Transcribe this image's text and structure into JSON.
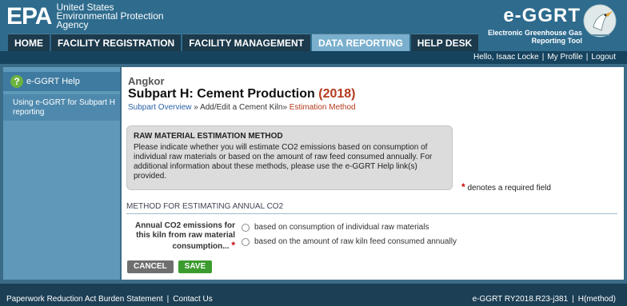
{
  "header": {
    "agency_mark": "EPA",
    "agency_line1": "United States",
    "agency_line2": "Environmental Protection",
    "agency_line3": "Agency",
    "brand_title": "e-GGRT",
    "brand_sub_line1": "Electronic Greenhouse Gas",
    "brand_sub_line2": "Reporting Tool"
  },
  "tabs": [
    {
      "label": "HOME"
    },
    {
      "label": "FACILITY REGISTRATION"
    },
    {
      "label": "FACILITY MANAGEMENT"
    },
    {
      "label": "DATA REPORTING",
      "active": true
    },
    {
      "label": "HELP DESK"
    }
  ],
  "userbar": {
    "greeting": "Hello, Isaac Locke",
    "my_profile": "My Profile",
    "logout": "Logout"
  },
  "sidebar": {
    "help_label": "e-GGRT Help",
    "help_icon": "?",
    "link_text": "Using e-GGRT for Subpart H reporting"
  },
  "main": {
    "facility_name": "Angkor",
    "title": "Subpart H: Cement Production",
    "title_year": "(2018)",
    "breadcrumb": {
      "item1": "Subpart Overview",
      "sep": "»",
      "item2": "Add/Edit a Cement Kiln",
      "item3": "Estimation Method"
    },
    "info_box": {
      "title": "RAW MATERIAL ESTIMATION METHOD",
      "body": "Please indicate whether you will estimate CO2 emissions based on consumption of individual raw materials or based on the amount of raw feed consumed annually. For additional information about these methods, please use the e-GGRT Help link(s) provided."
    },
    "required_note": "denotes a required field",
    "required_star": "*",
    "section_heading": "METHOD FOR ESTIMATING ANNUAL CO2",
    "field_label": "Annual CO2 emissions for this kiln from raw material consumption...",
    "options": [
      {
        "label": "based on consumption of individual raw materials",
        "selected": false
      },
      {
        "label": "based on the amount of raw kiln feed consumed annually",
        "selected": false
      }
    ],
    "buttons": {
      "cancel": "CANCEL",
      "save": "SAVE"
    }
  },
  "footer": {
    "paperwork": "Paperwork Reduction Act Burden Statement",
    "contact": "Contact Us",
    "version": "e-GGRT RY2018.R23-j381",
    "method": "H(method)"
  },
  "colors": {
    "header_bg": "#2e6b8d",
    "tab_active": "#7ab0cd",
    "title_year": "#b33a1c",
    "save_button": "#3c9b2e"
  }
}
